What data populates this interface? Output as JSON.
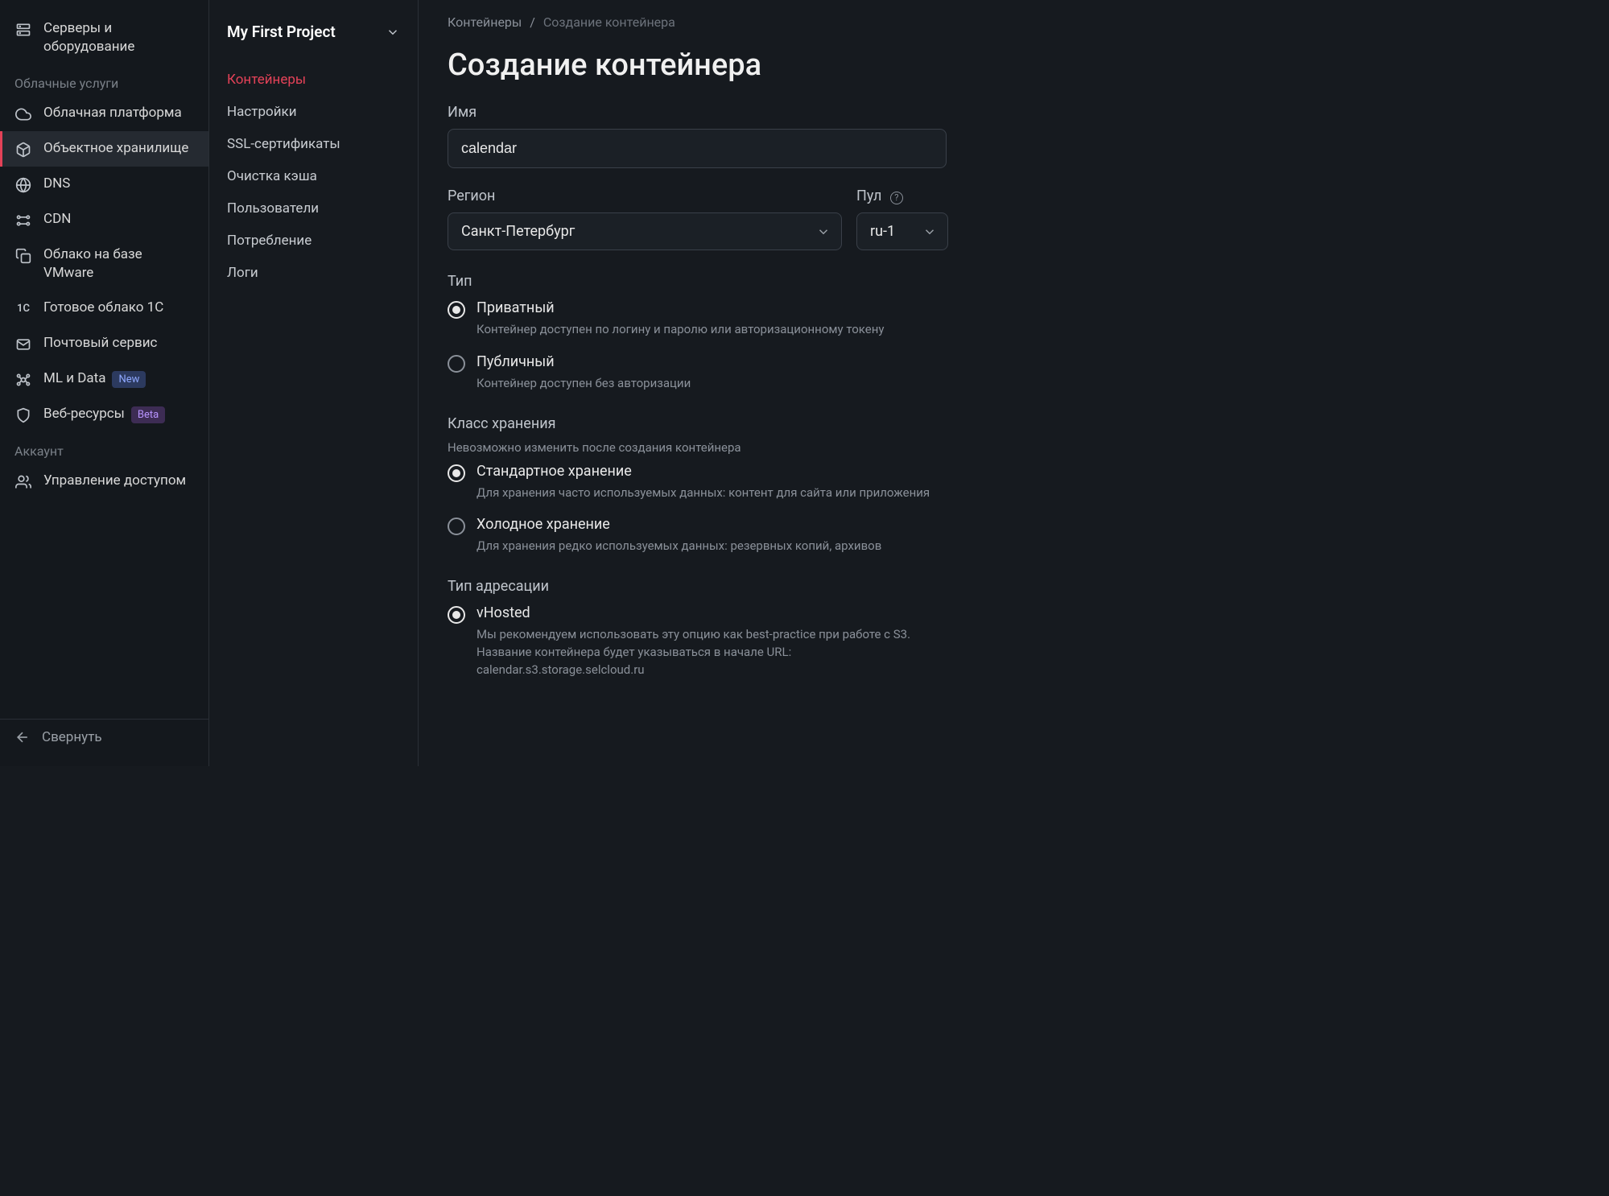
{
  "sidebar": {
    "top_item": "Серверы и оборудование",
    "section_cloud": "Облачные услуги",
    "items": [
      "Облачная платформа",
      "Объектное хранилище",
      "DNS",
      "CDN",
      "Облако на базе VMware",
      "Готовое облако 1С",
      "Почтовый сервис",
      "ML и Data",
      "Веб-ресурсы"
    ],
    "badge_new": "New",
    "badge_beta": "Beta",
    "section_account": "Аккаунт",
    "access_item": "Управление доступом",
    "collapse": "Свернуть"
  },
  "subnav": {
    "project": "My First Project",
    "items": [
      "Контейнеры",
      "Настройки",
      "SSL-сертификаты",
      "Очистка кэша",
      "Пользователи",
      "Потребление",
      "Логи"
    ]
  },
  "breadcrumb": {
    "parent": "Контейнеры",
    "sep": "/",
    "current": "Создание контейнера"
  },
  "page_title": "Создание контейнера",
  "form": {
    "name_label": "Имя",
    "name_value": "calendar",
    "region_label": "Регион",
    "region_value": "Санкт-Петербург",
    "pool_label": "Пул",
    "pool_value": "ru-1",
    "type_label": "Тип",
    "type_private": "Приватный",
    "type_private_desc": "Контейнер доступен по логину и паролю или авторизационному токену",
    "type_public": "Публичный",
    "type_public_desc": "Контейнер доступен без авторизации",
    "storage_label": "Класс хранения",
    "storage_sub": "Невозможно изменить после создания контейнера",
    "storage_std": "Стандартное хранение",
    "storage_std_desc": "Для хранения часто используемых данных: контент для сайта или приложения",
    "storage_cold": "Холодное хранение",
    "storage_cold_desc": "Для хранения редко используемых данных: резервных копий, архивов",
    "addressing_label": "Тип адресации",
    "addressing_vhosted": "vHosted",
    "addressing_vhosted_desc": "Мы рекомендуем использовать эту опцию как best-practice при работе с S3. Название контейнера будет указываться в начале URL: calendar.s3.storage.selcloud.ru"
  }
}
